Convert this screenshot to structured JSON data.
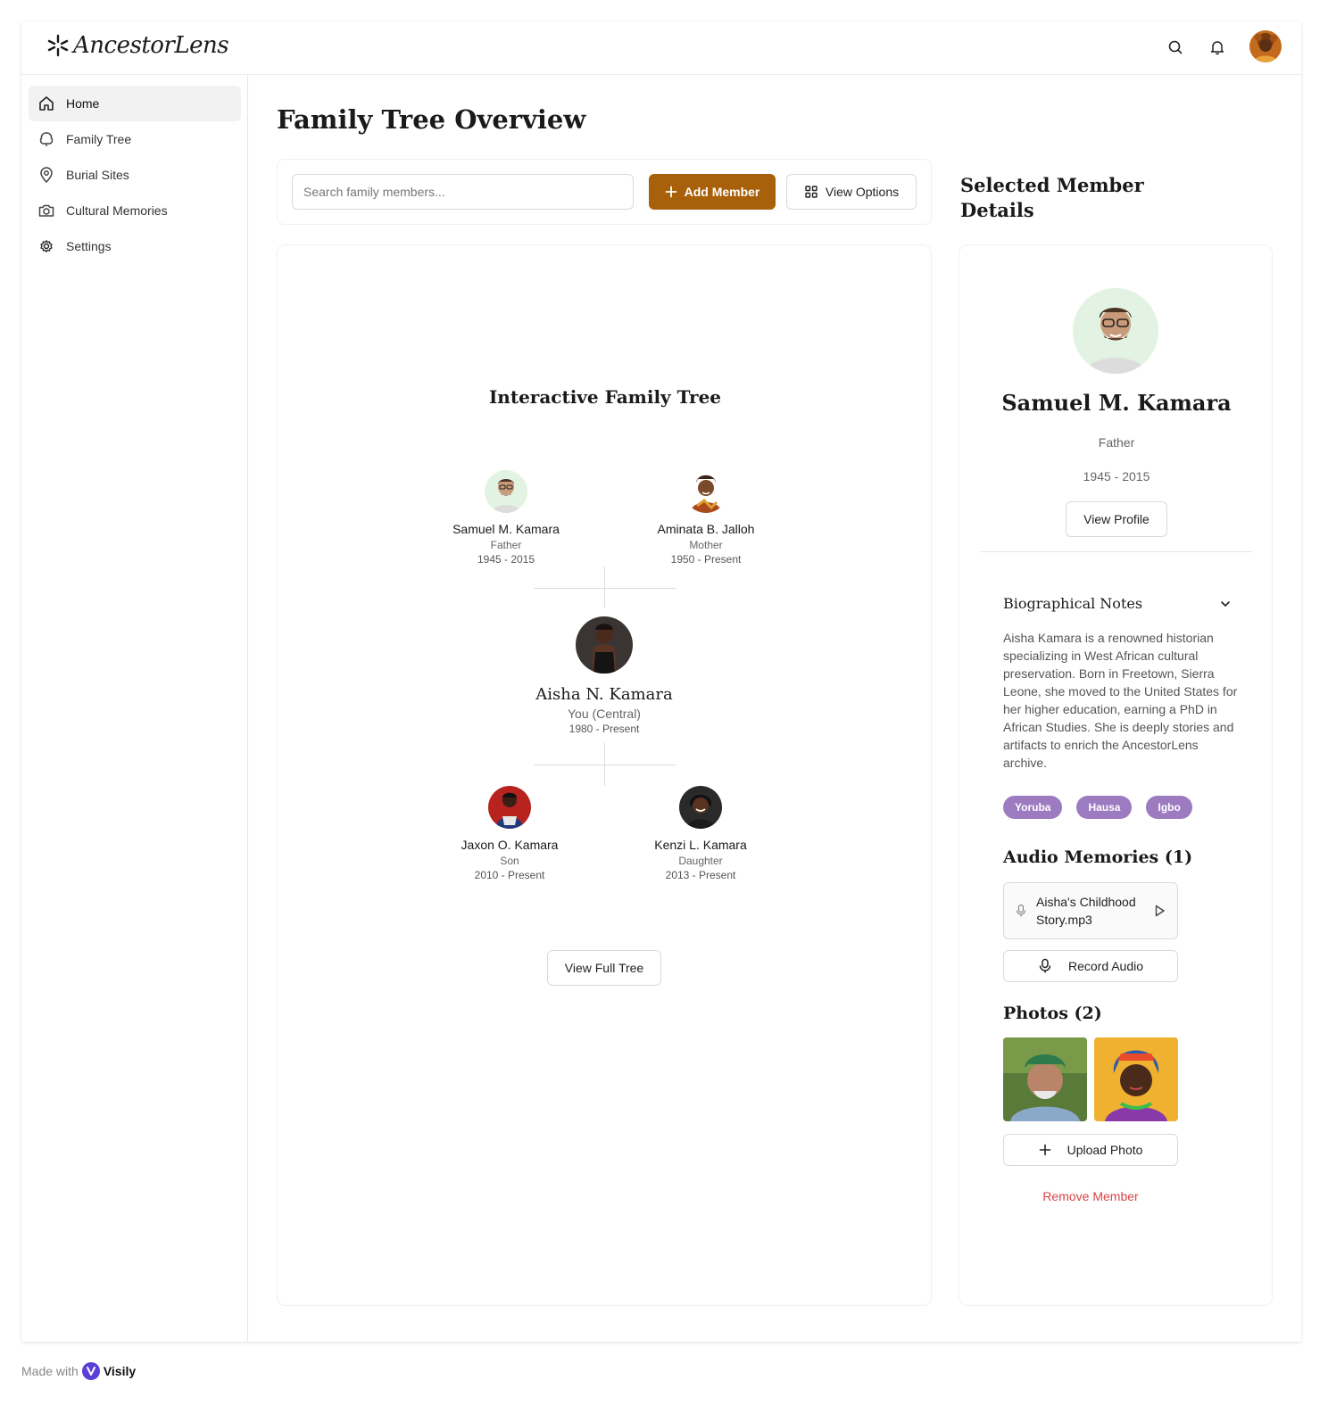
{
  "app": {
    "logo_text": "AncestorLens"
  },
  "icons": {
    "search": "search-icon",
    "bell": "bell-icon",
    "home": "home-icon",
    "tree": "tree-icon",
    "pin": "map-pin-icon",
    "camera": "camera-icon",
    "gear": "gear-icon",
    "plus": "plus-icon",
    "grid": "grid-icon",
    "chevron": "chevron-down-icon",
    "mic": "microphone-icon",
    "play": "play-icon"
  },
  "sidebar": {
    "items": [
      {
        "label": "Home"
      },
      {
        "label": "Family Tree"
      },
      {
        "label": "Burial Sites"
      },
      {
        "label": "Cultural Memories"
      },
      {
        "label": "Settings"
      }
    ]
  },
  "page": {
    "title": "Family Tree Overview"
  },
  "toolbar": {
    "search_placeholder": "Search family members...",
    "add_label": "Add Member",
    "view_options_label": "View Options"
  },
  "tree": {
    "title": "Interactive Family Tree",
    "parents": [
      {
        "name": "Samuel M. Kamara",
        "role": "Father",
        "years": "1945 - 2015"
      },
      {
        "name": "Aminata B. Jalloh",
        "role": "Mother",
        "years": "1950 - Present"
      }
    ],
    "central": {
      "name": "Aisha N. Kamara",
      "role": "You (Central)",
      "years": "1980 - Present"
    },
    "children": [
      {
        "name": "Jaxon O. Kamara",
        "role": "Son",
        "years": "2010 - Present"
      },
      {
        "name": "Kenzi L. Kamara",
        "role": "Daughter",
        "years": "2013 - Present"
      }
    ],
    "full_tree_label": "View Full Tree"
  },
  "details": {
    "heading": "Selected Member Details",
    "name": "Samuel M. Kamara",
    "role": "Father",
    "years": "1945 - 2015",
    "view_profile_label": "View Profile",
    "bio_title": "Biographical Notes",
    "bio_text": "Aisha Kamara is a renowned historian specializing in West African cultural preservation. Born in Freetown, Sierra Leone, she moved to the United States for her higher education, earning a PhD in African Studies. She is deeply stories and artifacts to enrich the AncestorLens archive.",
    "tags": [
      "Yoruba",
      "Hausa",
      "Igbo"
    ],
    "tag_color": "#9c7bc0",
    "audio_title": "Audio Memories (1)",
    "audio_files": [
      {
        "name": "Aisha's Childhood Story.mp3"
      }
    ],
    "record_label": "Record Audio",
    "photos_title": "Photos (2)",
    "upload_label": "Upload Photo",
    "remove_label": "Remove Member"
  },
  "colors": {
    "accent": "#a8600a",
    "danger": "#d64545"
  },
  "footer": {
    "made_with": "Made with",
    "brand": "Visily"
  }
}
